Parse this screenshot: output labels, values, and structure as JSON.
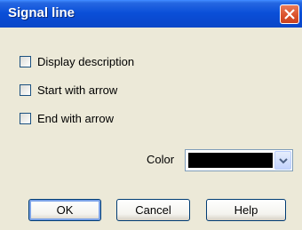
{
  "dialog": {
    "title": "Signal line"
  },
  "options": [
    {
      "label": "Display description",
      "checked": false
    },
    {
      "label": "Start with arrow",
      "checked": false
    },
    {
      "label": "End with arrow",
      "checked": false
    }
  ],
  "color": {
    "label": "Color",
    "value": "#000000"
  },
  "buttons": {
    "ok": "OK",
    "cancel": "Cancel",
    "help": "Help"
  },
  "icons": {
    "close": "close-icon",
    "dropdown": "chevron-down-icon"
  }
}
